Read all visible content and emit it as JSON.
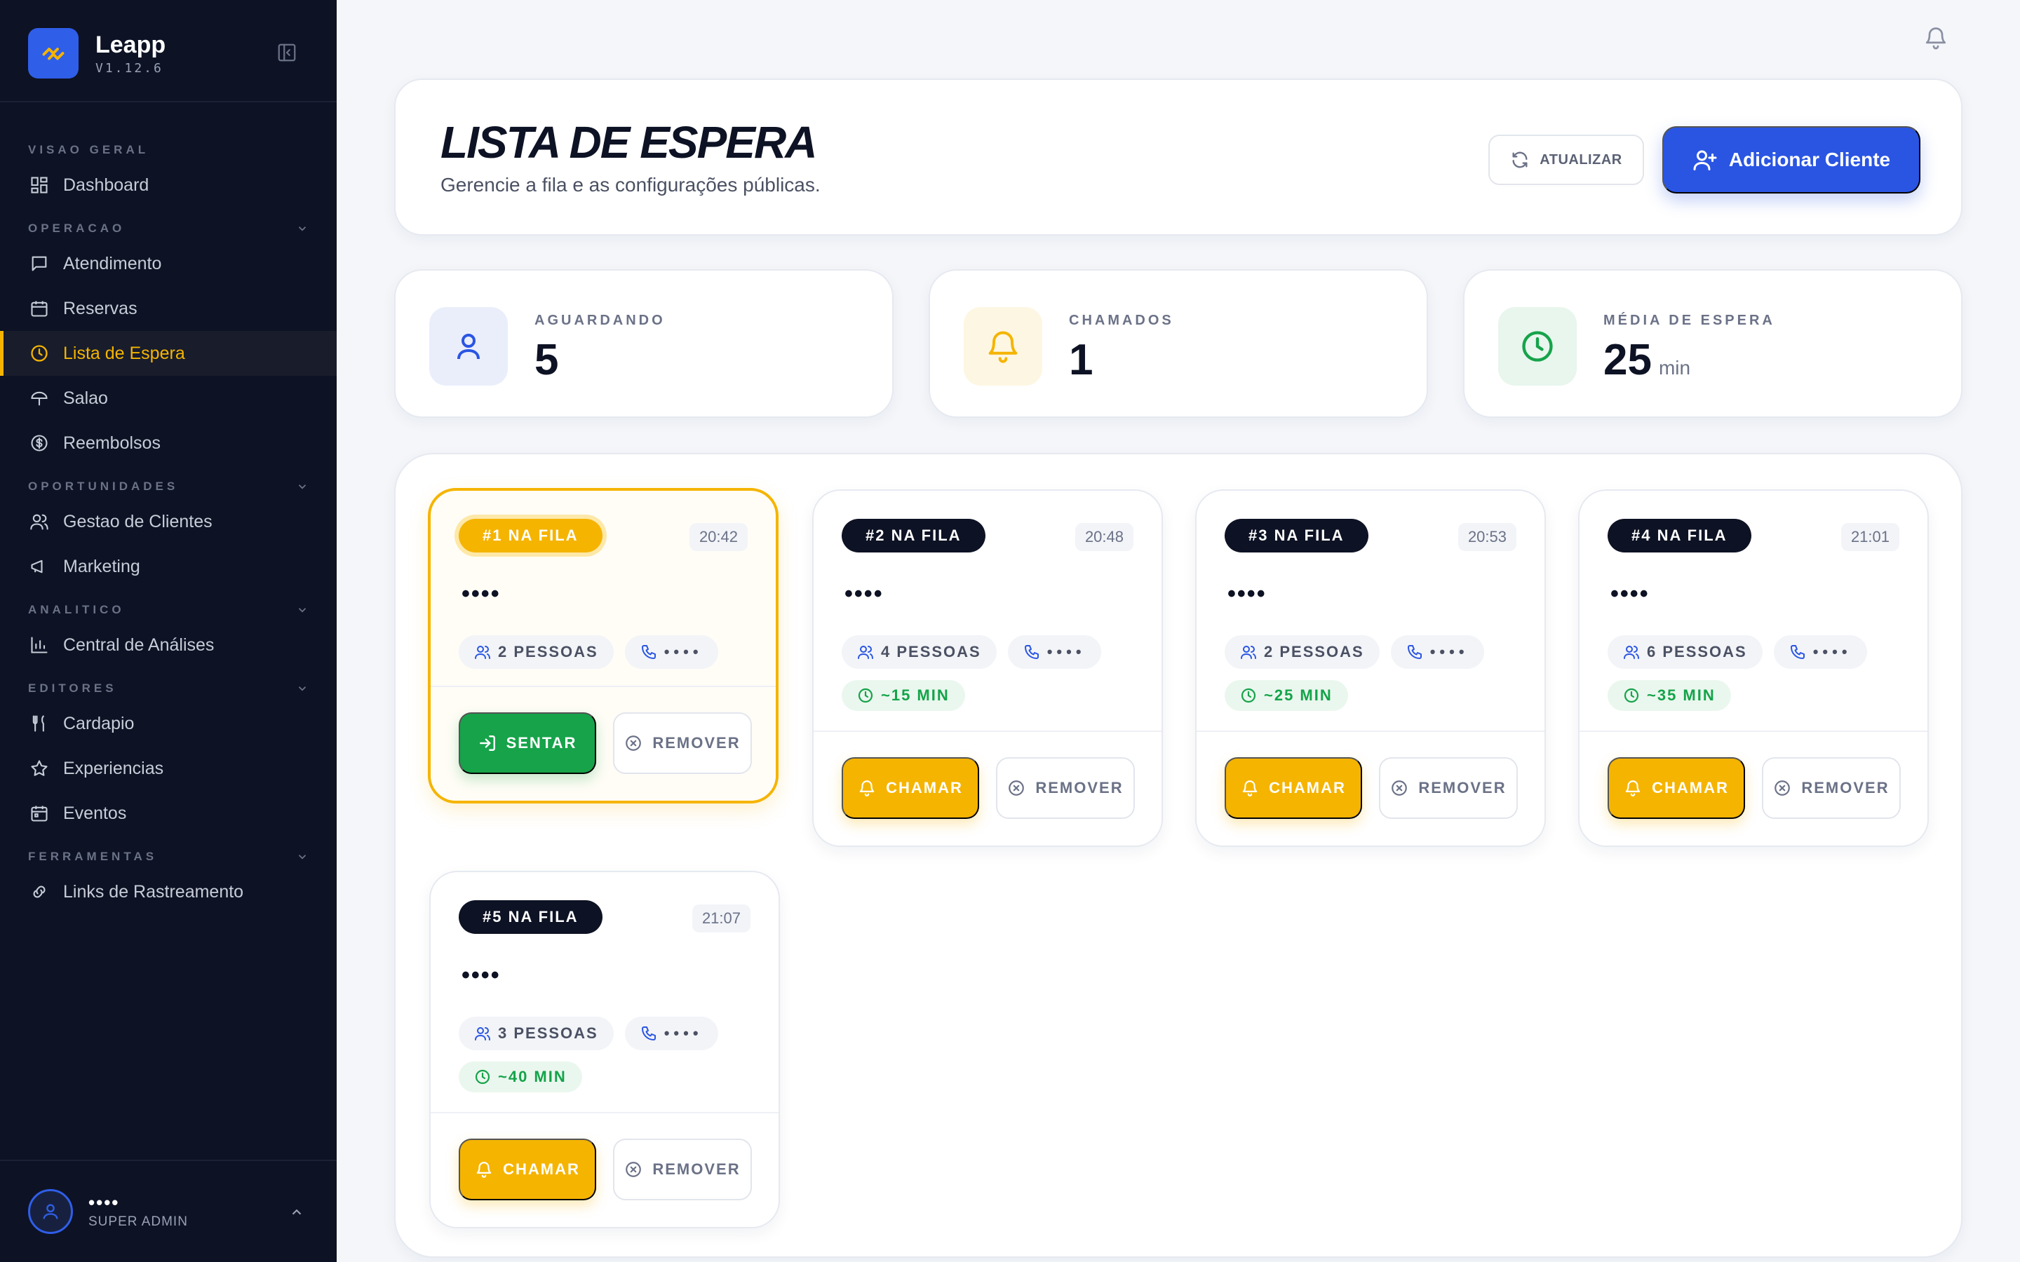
{
  "brand": {
    "name": "Leapp",
    "version": "V1.12.6"
  },
  "nav": {
    "sections": {
      "visao_geral": "VISAO GERAL",
      "operacao": "OPERACAO",
      "oportunidades": "OPORTUNIDADES",
      "analitico": "ANALITICO",
      "editores": "EDITORES",
      "ferramentas": "FERRAMENTAS"
    },
    "items": {
      "dashboard": "Dashboard",
      "atendimento": "Atendimento",
      "reservas": "Reservas",
      "lista_espera": "Lista de Espera",
      "salao": "Salao",
      "reembolsos": "Reembolsos",
      "gestao_clientes": "Gestao de Clientes",
      "marketing": "Marketing",
      "central_analises": "Central de Análises",
      "cardapio": "Cardapio",
      "experiencias": "Experiencias",
      "eventos": "Eventos",
      "links_rastreamento": "Links de Rastreamento"
    }
  },
  "user": {
    "name": "••••",
    "role": "SUPER ADMIN"
  },
  "header": {
    "title": "LISTA DE ESPERA",
    "subtitle": "Gerencie a fila e as configurações públicas.",
    "refresh_label": "ATUALIZAR",
    "add_label": "Adicionar Cliente"
  },
  "stats": {
    "waiting": {
      "label": "AGUARDANDO",
      "value": "5"
    },
    "called": {
      "label": "CHAMADOS",
      "value": "1"
    },
    "avg_wait": {
      "label": "MÉDIA DE ESPERA",
      "value": "25",
      "unit": "min"
    }
  },
  "queue": [
    {
      "position": "#1 NA FILA",
      "time": "20:42",
      "name": "••••",
      "people": "2 PESSOAS",
      "phone": "••••",
      "action": "SENTAR",
      "remove": "REMOVER"
    },
    {
      "position": "#2 NA FILA",
      "time": "20:48",
      "name": "••••",
      "people": "4 PESSOAS",
      "phone": "••••",
      "eta": "~15 MIN",
      "action": "CHAMAR",
      "remove": "REMOVER"
    },
    {
      "position": "#3 NA FILA",
      "time": "20:53",
      "name": "••••",
      "people": "2 PESSOAS",
      "phone": "••••",
      "eta": "~25 MIN",
      "action": "CHAMAR",
      "remove": "REMOVER"
    },
    {
      "position": "#4 NA FILA",
      "time": "21:01",
      "name": "••••",
      "people": "6 PESSOAS",
      "phone": "••••",
      "eta": "~35 MIN",
      "action": "CHAMAR",
      "remove": "REMOVER"
    },
    {
      "position": "#5 NA FILA",
      "time": "21:07",
      "name": "••••",
      "people": "3 PESSOAS",
      "phone": "••••",
      "eta": "~40 MIN",
      "action": "CHAMAR",
      "remove": "REMOVER"
    }
  ],
  "colors": {
    "brand": "#2a55e3",
    "accent": "#f5b400",
    "success": "#16a34a",
    "sidebar": "#0d1224"
  },
  "icons": {
    "logo": "trend-logo-icon",
    "bell": "bell-icon",
    "user": "user-icon",
    "clock": "clock-icon",
    "phone": "phone-icon",
    "people": "users-icon"
  }
}
